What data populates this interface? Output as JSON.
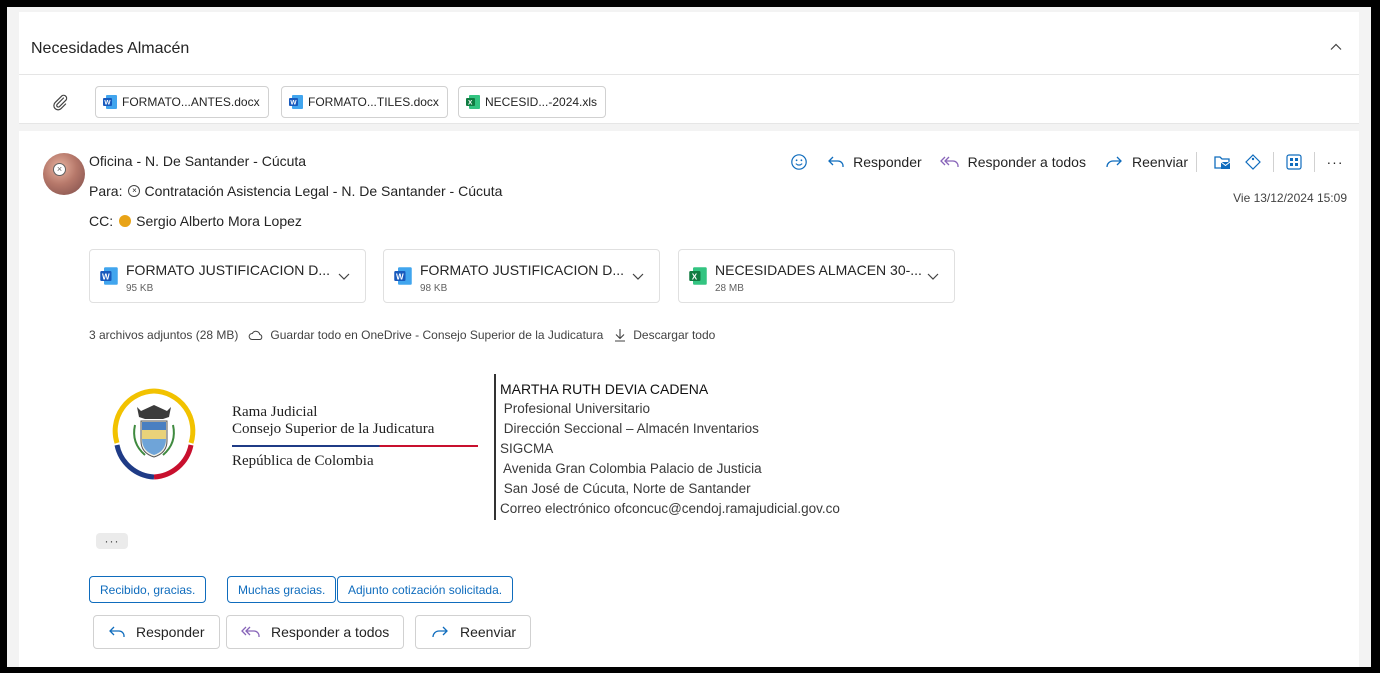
{
  "thread": {
    "title": "Necesidades Almacén",
    "attachments": [
      {
        "name": "FORMATO...ANTES.docx",
        "type": "word-icon"
      },
      {
        "name": "FORMATO...TILES.docx",
        "type": "word-icon"
      },
      {
        "name": "NECESID...-2024.xls",
        "type": "excel-icon"
      }
    ]
  },
  "message": {
    "sender": "Oficina - N. De Santander - Cúcuta",
    "to_label": "Para:",
    "to": "Contratación Asistencia Legal - N. De Santander - Cúcuta",
    "cc_label": "CC:",
    "cc": "Sergio Alberto Mora Lopez",
    "date": "Vie 13/12/2024 15:09",
    "actions": {
      "reply": "Responder",
      "reply_all": "Responder a todos",
      "forward": "Reenviar",
      "more": "···"
    },
    "attachments": [
      {
        "name": "FORMATO JUSTIFICACION D...",
        "size": "95 KB",
        "type": "word-icon"
      },
      {
        "name": "FORMATO JUSTIFICACION D...",
        "size": "98 KB",
        "type": "word-icon"
      },
      {
        "name": "NECESIDADES ALMACEN 30-...",
        "size": "28 MB",
        "type": "excel-icon"
      }
    ],
    "attachment_summary": "3 archivos adjuntos (28 MB)",
    "save_onedrive": "Guardar todo en OneDrive - Consejo Superior de la Judicatura",
    "download_all": "Descargar todo"
  },
  "signature": {
    "org_line1": "Rama Judicial",
    "org_line2": "Consejo Superior de la Judicatura",
    "org_line3": "República de Colombia",
    "lines": [
      "MARTHA RUTH DEVIA CADENA",
      " Profesional Universitario",
      " Dirección Seccional – Almacén Inventarios",
      "SIGCMA",
      " Avenida Gran Colombia Palacio de Justicia",
      " San José de Cúcuta, Norte de Santander",
      "Correo electrónico ofconcuc@cendoj.ramajudicial.gov.co"
    ]
  },
  "more_dots": "···",
  "quick_replies": [
    "Recibido, gracias.",
    "Muchas gracias.",
    "Adjunto cotización solicitada."
  ],
  "bottom_actions": {
    "reply": "Responder",
    "reply_all": "Responder a todos",
    "forward": "Reenviar"
  },
  "colors": {
    "accent": "#0f6cbd",
    "reply_all_purple": "#8764b8",
    "forward_blue": "#0f6cbd",
    "word_blue": "#185abd",
    "excel_green": "#107c41"
  }
}
